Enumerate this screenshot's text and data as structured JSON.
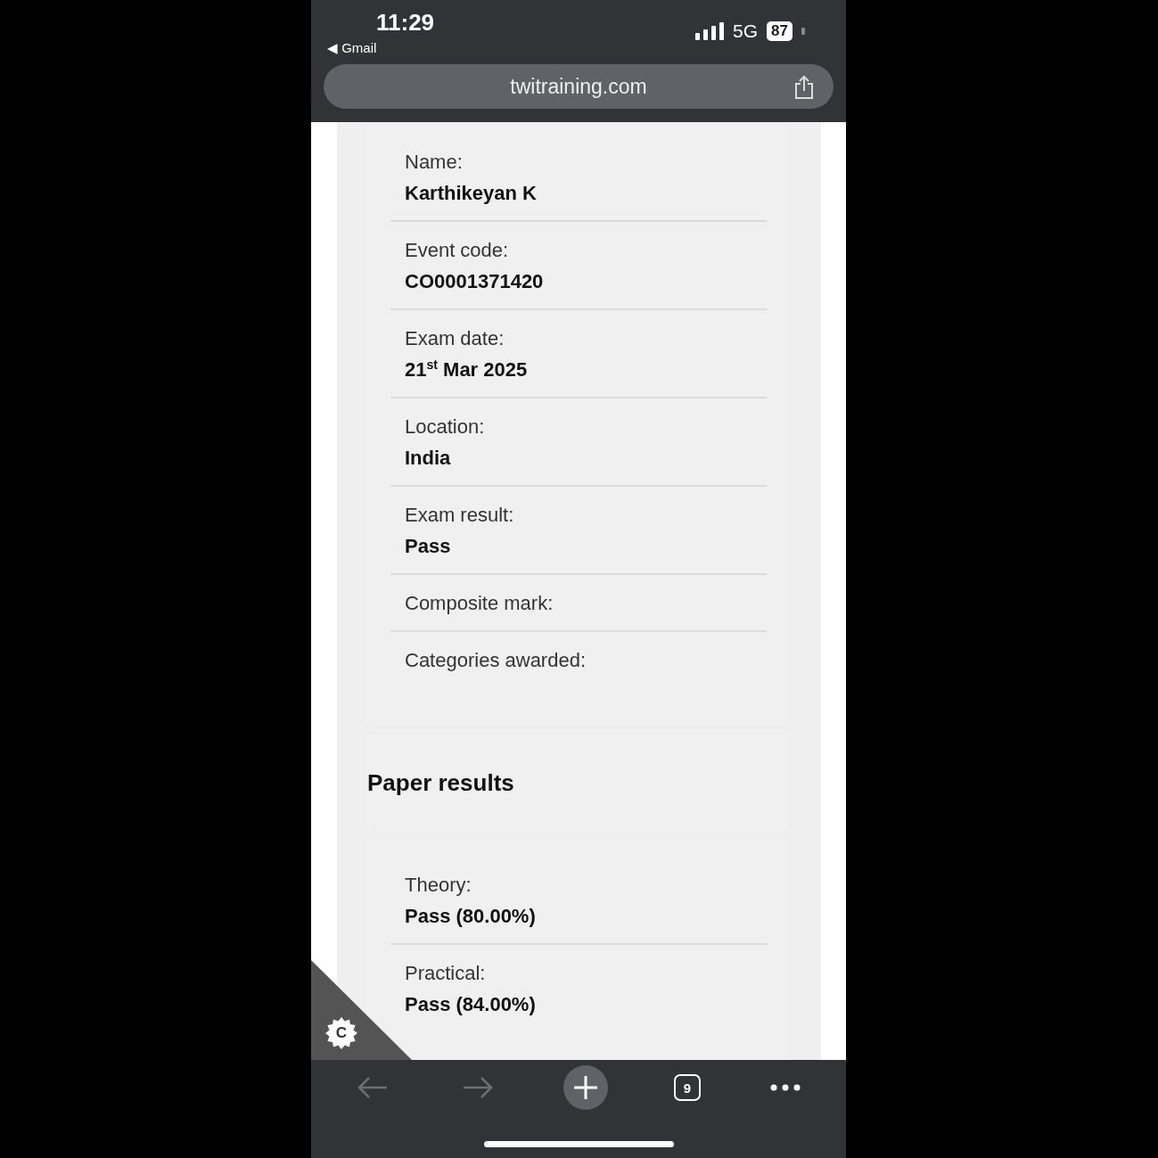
{
  "status_bar": {
    "time": "11:29",
    "back_app": "◀ Gmail",
    "network": "5G",
    "battery": "87"
  },
  "address_bar": {
    "url": "twitraining.com"
  },
  "exam_details": [
    {
      "label": "Name:",
      "value": "Karthikeyan K"
    },
    {
      "label": "Event code:",
      "value": "CO0001371420"
    },
    {
      "label": "Exam date:",
      "value": "21$^{st}$ Mar 2025"
    },
    {
      "label": "Location:",
      "value": "India"
    },
    {
      "label": "Exam result:",
      "value": "Pass"
    },
    {
      "label": "Composite mark:"
    },
    {
      "label": "Categories awarded:"
    }
  ],
  "paper_results": {
    "title": "Paper results",
    "rows": [
      {
        "label": "Theory:",
        "value": "Pass (80.00%)"
      },
      {
        "label": "Practical:",
        "value": "Pass (84.00%)"
      }
    ]
  },
  "corner_badge": {
    "letter": "C"
  },
  "toolbar": {
    "buttons": [
      {
        "kind": "back",
        "disabled": true
      },
      {
        "kind": "forward",
        "disabled": true
      },
      {
        "kind": "new_tab",
        "disabled": false
      },
      {
        "kind": "tabs",
        "label": "9",
        "disabled": false
      },
      {
        "kind": "more",
        "disabled": false
      }
    ]
  }
}
